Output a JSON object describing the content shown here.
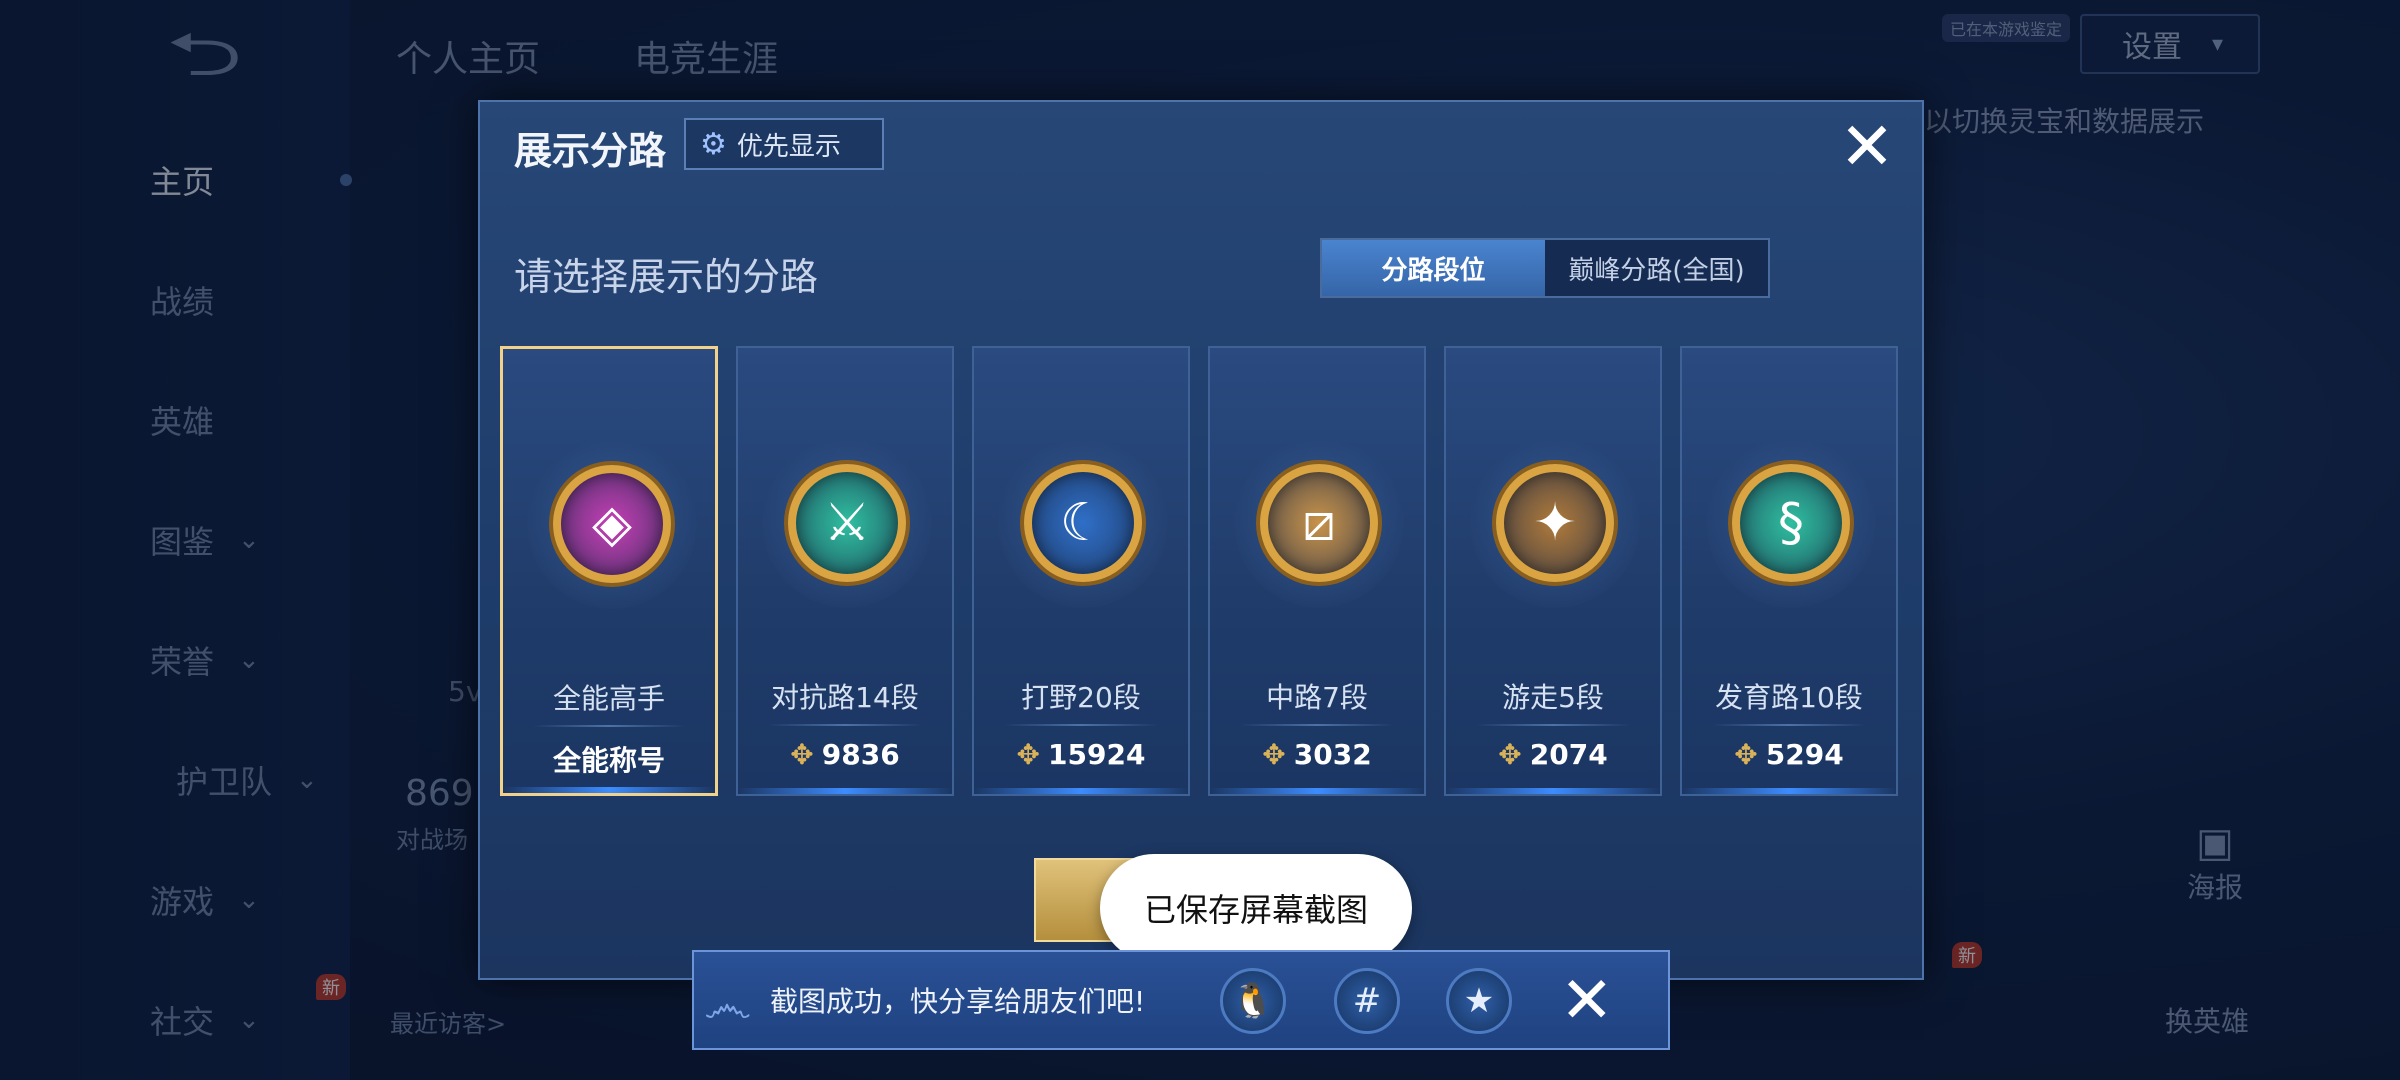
{
  "sidebar": {
    "items": [
      {
        "label": "主页",
        "active": true,
        "chevron": false
      },
      {
        "label": "战绩",
        "active": false,
        "chevron": false
      },
      {
        "label": "英雄",
        "active": false,
        "chevron": false
      },
      {
        "label": "图鉴",
        "active": false,
        "chevron": true
      },
      {
        "label": "荣誉",
        "active": false,
        "chevron": true
      },
      {
        "label": "护卫队",
        "active": false,
        "chevron": true
      },
      {
        "label": "游戏",
        "active": false,
        "chevron": true
      },
      {
        "label": "社交",
        "active": false,
        "chevron": true
      }
    ],
    "new_badge": "新"
  },
  "header": {
    "tab_profile": "个人主页",
    "tab_career": "电竞生涯",
    "settings_label": "设置",
    "small_pill": "已在本游戏鉴定",
    "hint": "以切换灵宝和数据展示"
  },
  "background": {
    "number": "869",
    "label": "对战场",
    "v_text": "5v",
    "recent_visitors": "最近访客>",
    "poster": "海报",
    "swap_hero": "换英雄",
    "new_badge_right": "新"
  },
  "modal": {
    "title": "展示分路",
    "priority_button": "优先显示",
    "close_icon": "✕",
    "subtitle": "请选择展示的分路",
    "toggle": {
      "option_active": "分路段位",
      "option_inactive": "巅峰分路(全国)"
    },
    "cards": [
      {
        "name": "全能高手",
        "value": "全能称号",
        "show_points_icon": false,
        "emblem_color": "#c63fb6",
        "emblem_glyph": "◈",
        "selected": true
      },
      {
        "name": "对抗路14段",
        "value": "9836",
        "show_points_icon": true,
        "emblem_color": "#2fbfa0",
        "emblem_glyph": "⚔",
        "selected": false
      },
      {
        "name": "打野20段",
        "value": "15924",
        "show_points_icon": true,
        "emblem_color": "#2f6fc8",
        "emblem_glyph": "☾",
        "selected": false
      },
      {
        "name": "中路7段",
        "value": "3032",
        "show_points_icon": true,
        "emblem_color": "#c9934a",
        "emblem_glyph": "⧄",
        "selected": false
      },
      {
        "name": "游走5段",
        "value": "2074",
        "show_points_icon": true,
        "emblem_color": "#b07a3a",
        "emblem_glyph": "✦",
        "selected": false
      },
      {
        "name": "发育路10段",
        "value": "5294",
        "show_points_icon": true,
        "emblem_color": "#2fbfa0",
        "emblem_glyph": "§",
        "selected": false
      }
    ]
  },
  "toast": {
    "text": "已保存屏幕截图"
  },
  "share_bar": {
    "text": "截图成功，快分享给朋友们吧!",
    "icons": [
      "qq-icon",
      "wechat-moments-icon",
      "qzone-icon"
    ]
  }
}
